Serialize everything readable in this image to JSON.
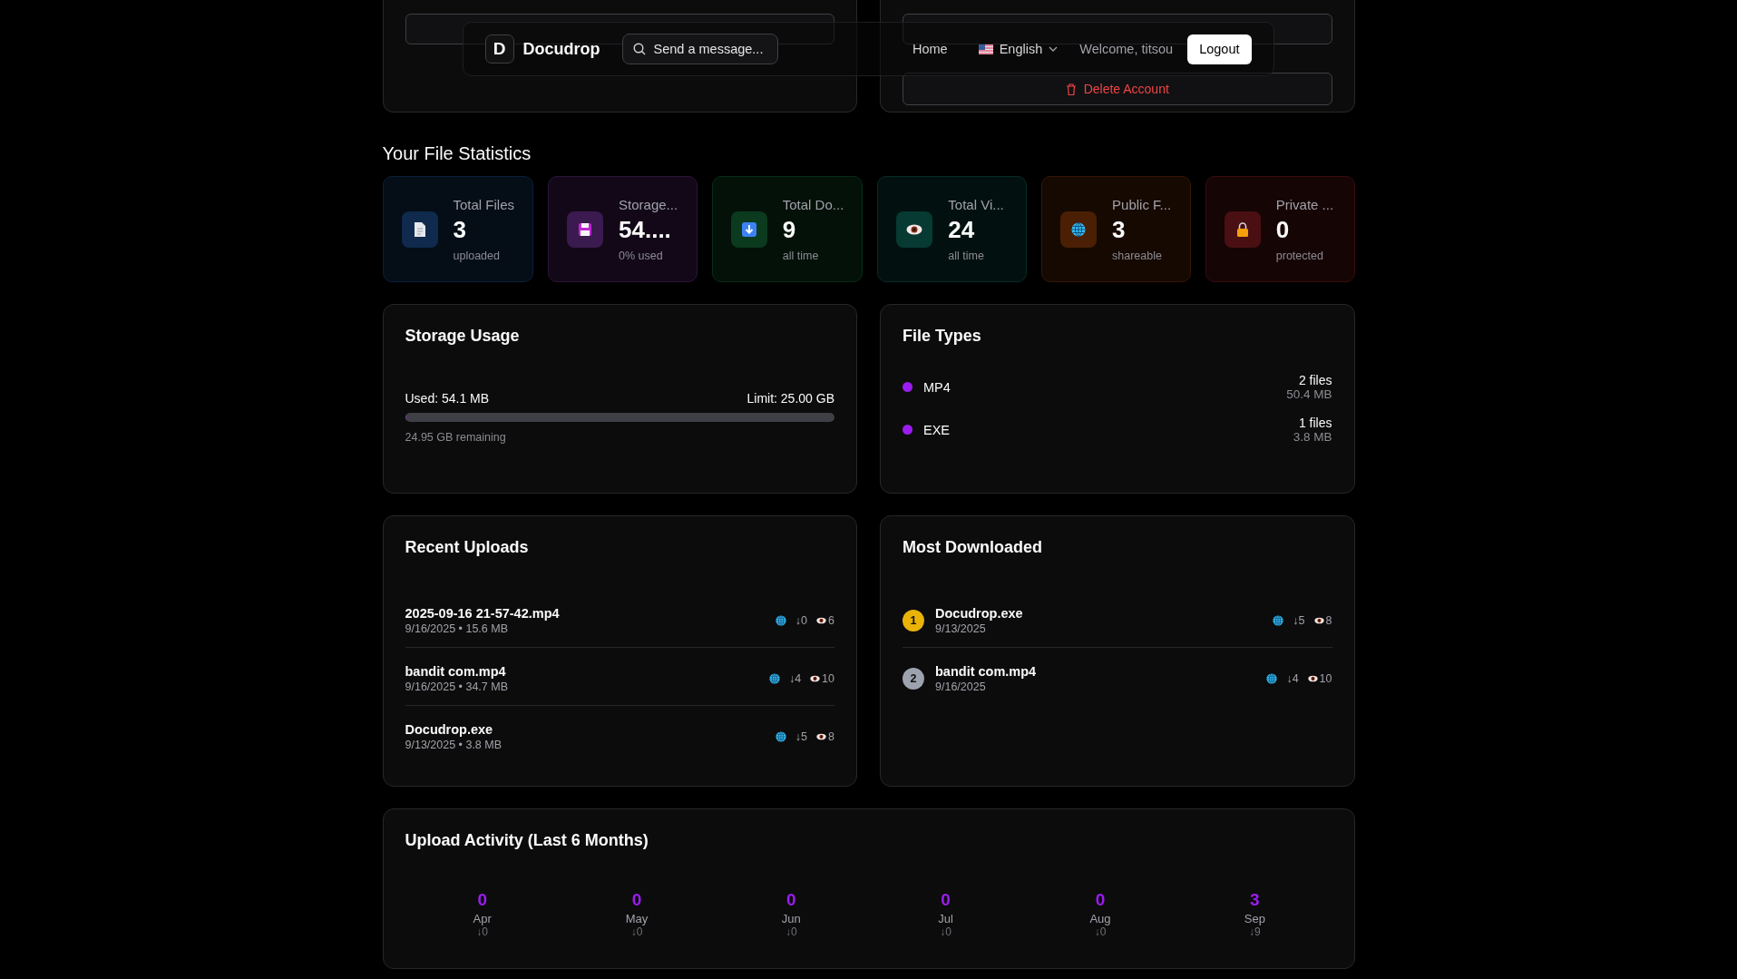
{
  "background_panels": {
    "delete_button": "Delete Account"
  },
  "nav": {
    "logo_letter": "D",
    "brand": "Docudrop",
    "search": {
      "placeholder": "Send a message..."
    },
    "links": [
      "Home"
    ],
    "language": "English",
    "welcome": "Welcome, titsou",
    "logout": "Logout"
  },
  "stats_title": "Your File Statistics",
  "stats": [
    {
      "kind": "document",
      "label": "Total Files",
      "value": "3",
      "sub": "uploaded",
      "color": "#0f2a4d"
    },
    {
      "kind": "disk",
      "label": "Storage...",
      "value": "54....",
      "sub": "0% used",
      "color": "#3b1a4f"
    },
    {
      "kind": "download",
      "label": "Total Do...",
      "value": "9",
      "sub": "all time",
      "color": "#0b3a1e"
    },
    {
      "kind": "eye",
      "label": "Total Vi...",
      "value": "24",
      "sub": "all time",
      "color": "#063a33"
    },
    {
      "kind": "globe",
      "label": "Public F...",
      "value": "3",
      "sub": "shareable",
      "color": "#4a1f04"
    },
    {
      "kind": "lock",
      "label": "Private ...",
      "value": "0",
      "sub": "protected",
      "color": "#4a0f12"
    }
  ],
  "storage": {
    "title": "Storage Usage",
    "used": "Used: 54.1 MB",
    "limit": "Limit: 25.00 GB",
    "level": 0.002,
    "remaining": "24.95 GB remaining"
  },
  "file_types": {
    "title": "File Types",
    "items": [
      {
        "name": "MP4",
        "color": "#9b1cf0",
        "count": "2 files",
        "size": "50.4 MB"
      },
      {
        "name": "EXE",
        "color": "#9b1cf0",
        "count": "1 files",
        "size": "3.8 MB"
      }
    ]
  },
  "recent_uploads": {
    "title": "Recent Uploads",
    "items": [
      {
        "name": "2025-09-16 21-57-42.mp4",
        "meta": "9/16/2025 • 15.6 MB",
        "downloads": "↓0",
        "views": "6"
      },
      {
        "name": "bandit com.mp4",
        "meta": "9/16/2025 • 34.7 MB",
        "downloads": "↓4",
        "views": "10"
      },
      {
        "name": "Docudrop.exe",
        "meta": "9/13/2025 • 3.8 MB",
        "downloads": "↓5",
        "views": "8"
      }
    ]
  },
  "most_downloaded": {
    "title": "Most Downloaded",
    "items": [
      {
        "rank": "1",
        "color": "#eab308",
        "name": "Docudrop.exe",
        "meta": "9/13/2025",
        "downloads": "↓5",
        "views": "8"
      },
      {
        "rank": "2",
        "color": "#9ca3af",
        "name": "bandit com.mp4",
        "meta": "9/16/2025",
        "downloads": "↓4",
        "views": "10"
      }
    ]
  },
  "activity": {
    "title": "Upload Activity (Last 6 Months)",
    "months": [
      {
        "count": "0",
        "month": "Apr",
        "downloads": "↓0"
      },
      {
        "count": "0",
        "month": "May",
        "downloads": "↓0"
      },
      {
        "count": "0",
        "month": "Jun",
        "downloads": "↓0"
      },
      {
        "count": "0",
        "month": "Jul",
        "downloads": "↓0"
      },
      {
        "count": "0",
        "month": "Aug",
        "downloads": "↓0"
      },
      {
        "count": "3",
        "month": "Sep",
        "downloads": "↓9"
      }
    ]
  }
}
